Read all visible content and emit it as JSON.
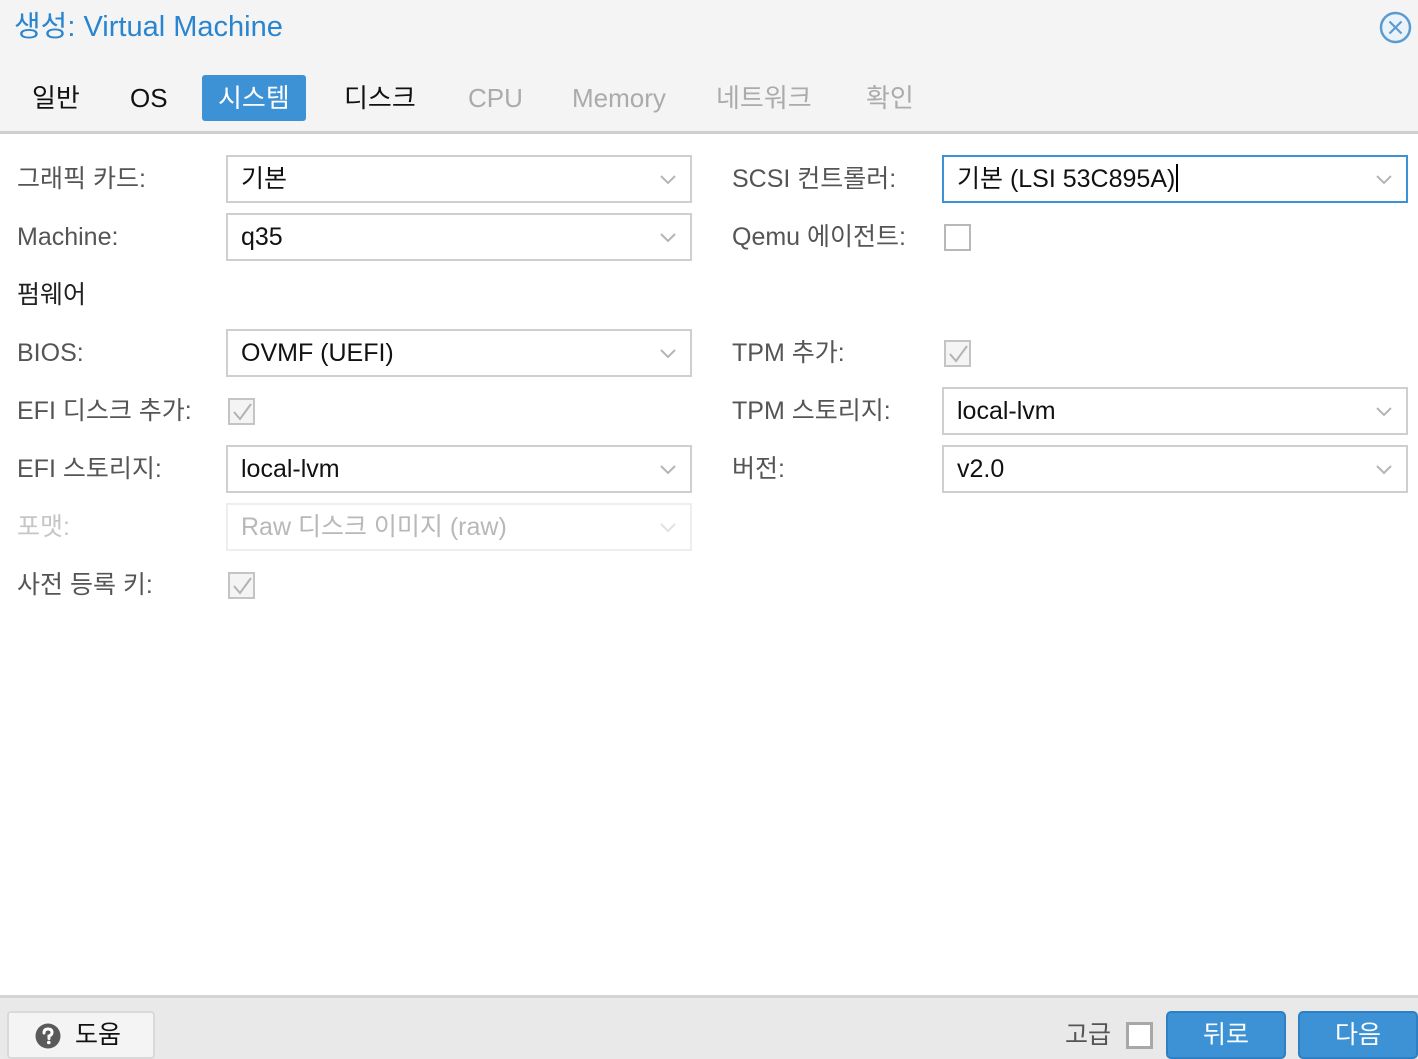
{
  "window": {
    "title": "생성: Virtual Machine",
    "close_icon": "close-circle-icon"
  },
  "tabs": [
    {
      "label": "일반",
      "state": "normal"
    },
    {
      "label": "OS",
      "state": "normal"
    },
    {
      "label": "시스템",
      "state": "active"
    },
    {
      "label": "디스크",
      "state": "normal"
    },
    {
      "label": "CPU",
      "state": "disabled"
    },
    {
      "label": "Memory",
      "state": "disabled"
    },
    {
      "label": "네트워크",
      "state": "disabled"
    },
    {
      "label": "확인",
      "state": "disabled"
    }
  ],
  "form": {
    "graphics_card": {
      "label": "그래픽 카드:",
      "value": "기본"
    },
    "machine": {
      "label": "Machine:",
      "value": "q35"
    },
    "firmware_section": "펌웨어",
    "bios": {
      "label": "BIOS:",
      "value": "OVMF (UEFI)"
    },
    "efi_disk_add": {
      "label": "EFI 디스크 추가:",
      "checked": true
    },
    "efi_storage": {
      "label": "EFI 스토리지:",
      "value": "local-lvm"
    },
    "format": {
      "label": "포맷:",
      "value": "Raw 디스크 이미지 (raw)",
      "disabled": true
    },
    "pre_enrolled_keys": {
      "label": "사전 등록 키:",
      "checked": true
    },
    "scsi_controller": {
      "label": "SCSI 컨트롤러:",
      "value": "기본 (LSI 53C895A)",
      "focused": true
    },
    "qemu_agent": {
      "label": "Qemu 에이전트:",
      "checked": false
    },
    "tpm_add": {
      "label": "TPM 추가:",
      "checked": true
    },
    "tpm_storage": {
      "label": "TPM 스토리지:",
      "value": "local-lvm"
    },
    "version": {
      "label": "버전:",
      "value": "v2.0"
    }
  },
  "footer": {
    "help_label": "도움",
    "help_icon": "question-circle-icon",
    "advanced_label": "고급",
    "advanced_checked": false,
    "back_label": "뒤로",
    "next_label": "다음"
  },
  "colors": {
    "accent": "#3c92d5",
    "title": "#2a85cf"
  }
}
